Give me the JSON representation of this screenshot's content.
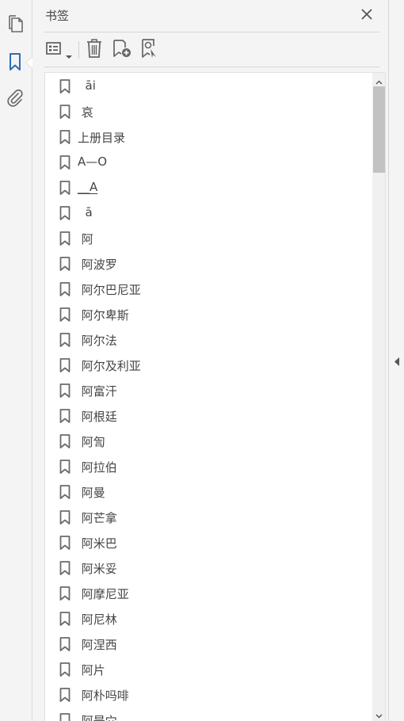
{
  "panel": {
    "title": "书签"
  },
  "toolbar": {
    "icons": [
      "options-list-icon",
      "trash-icon",
      "new-bookmark-icon",
      "find-bookmark-icon"
    ]
  },
  "rail": {
    "icons": [
      "pages-icon",
      "bookmark-icon",
      "attachment-icon"
    ],
    "active": "bookmark-icon"
  },
  "colors": {
    "active_icon": "#2d6fb4",
    "icon_gray": "#6b6b6b",
    "list_bg": "#ffffff",
    "panel_bg": "#f4f4f4",
    "scroll_thumb": "#c2c2c2"
  },
  "bookmarks": [
    {
      "label": "  āi",
      "underline": false
    },
    {
      "label": " 哀",
      "underline": false
    },
    {
      "label": "上册目录",
      "underline": false
    },
    {
      "label": "A—O",
      "underline": false
    },
    {
      "label": "__A",
      "underline": true
    },
    {
      "label": "  ā",
      "underline": false
    },
    {
      "label": " 阿",
      "underline": false
    },
    {
      "label": " 阿波罗",
      "underline": false
    },
    {
      "label": " 阿尔巴尼亚",
      "underline": false
    },
    {
      "label": " 阿尔卑斯",
      "underline": false
    },
    {
      "label": " 阿尔法",
      "underline": false
    },
    {
      "label": " 阿尔及利亚",
      "underline": false
    },
    {
      "label": " 阿富汗",
      "underline": false
    },
    {
      "label": " 阿根廷",
      "underline": false
    },
    {
      "label": " 阿訇",
      "underline": false
    },
    {
      "label": " 阿拉伯",
      "underline": false
    },
    {
      "label": " 阿曼",
      "underline": false
    },
    {
      "label": " 阿芒拿",
      "underline": false
    },
    {
      "label": " 阿米巴",
      "underline": false
    },
    {
      "label": " 阿米妥",
      "underline": false
    },
    {
      "label": " 阿摩尼亚",
      "underline": false
    },
    {
      "label": " 阿尼林",
      "underline": false
    },
    {
      "label": " 阿涅西",
      "underline": false
    },
    {
      "label": " 阿片",
      "underline": false
    },
    {
      "label": " 阿朴吗啡",
      "underline": false
    },
    {
      "label": " 阿是穴",
      "underline": false
    }
  ]
}
